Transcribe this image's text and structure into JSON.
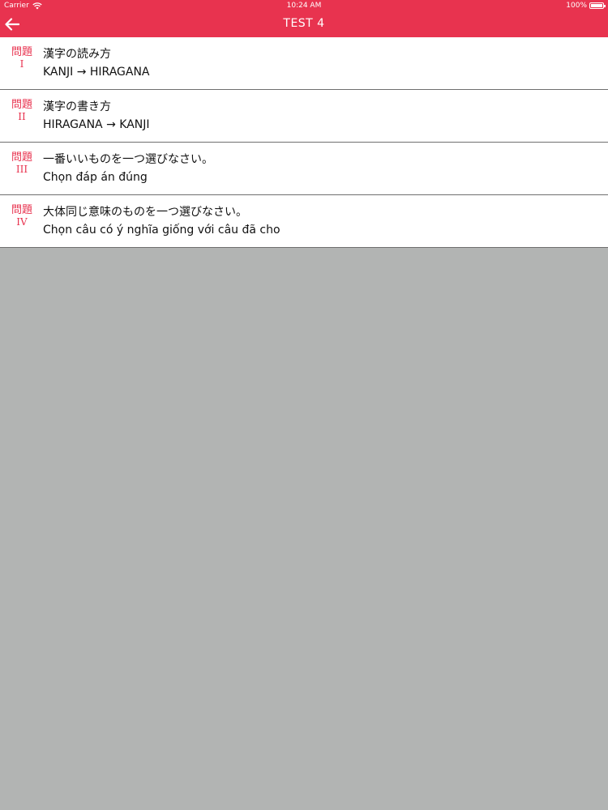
{
  "status_bar": {
    "carrier": "Carrier",
    "time": "10:24 AM",
    "battery": "100%",
    "icons": [
      "wifi-icon",
      "battery-icon"
    ]
  },
  "nav": {
    "title": "TEST 4",
    "back_icon": "arrow-left-icon"
  },
  "colors": {
    "accent": "#e8334f",
    "background": "#b2b4b3",
    "row_background": "#ffffff",
    "divider": "#6f6f6f"
  },
  "items": [
    {
      "badge": "問題",
      "numeral": "I",
      "title": "漢字の読み方",
      "subtitle": "KANJI → HIRAGANA"
    },
    {
      "badge": "問題",
      "numeral": "II",
      "title": "漢字の書き方",
      "subtitle": "HIRAGANA → KANJI"
    },
    {
      "badge": "問題",
      "numeral": "III",
      "title": "一番いいものを一つ選びなさい。",
      "subtitle": "Chọn đáp án đúng"
    },
    {
      "badge": "問題",
      "numeral": "IV",
      "title": "大体同じ意味のものを一つ選びなさい。",
      "subtitle": "Chọn câu có ý nghĩa giống với câu đã cho"
    }
  ]
}
